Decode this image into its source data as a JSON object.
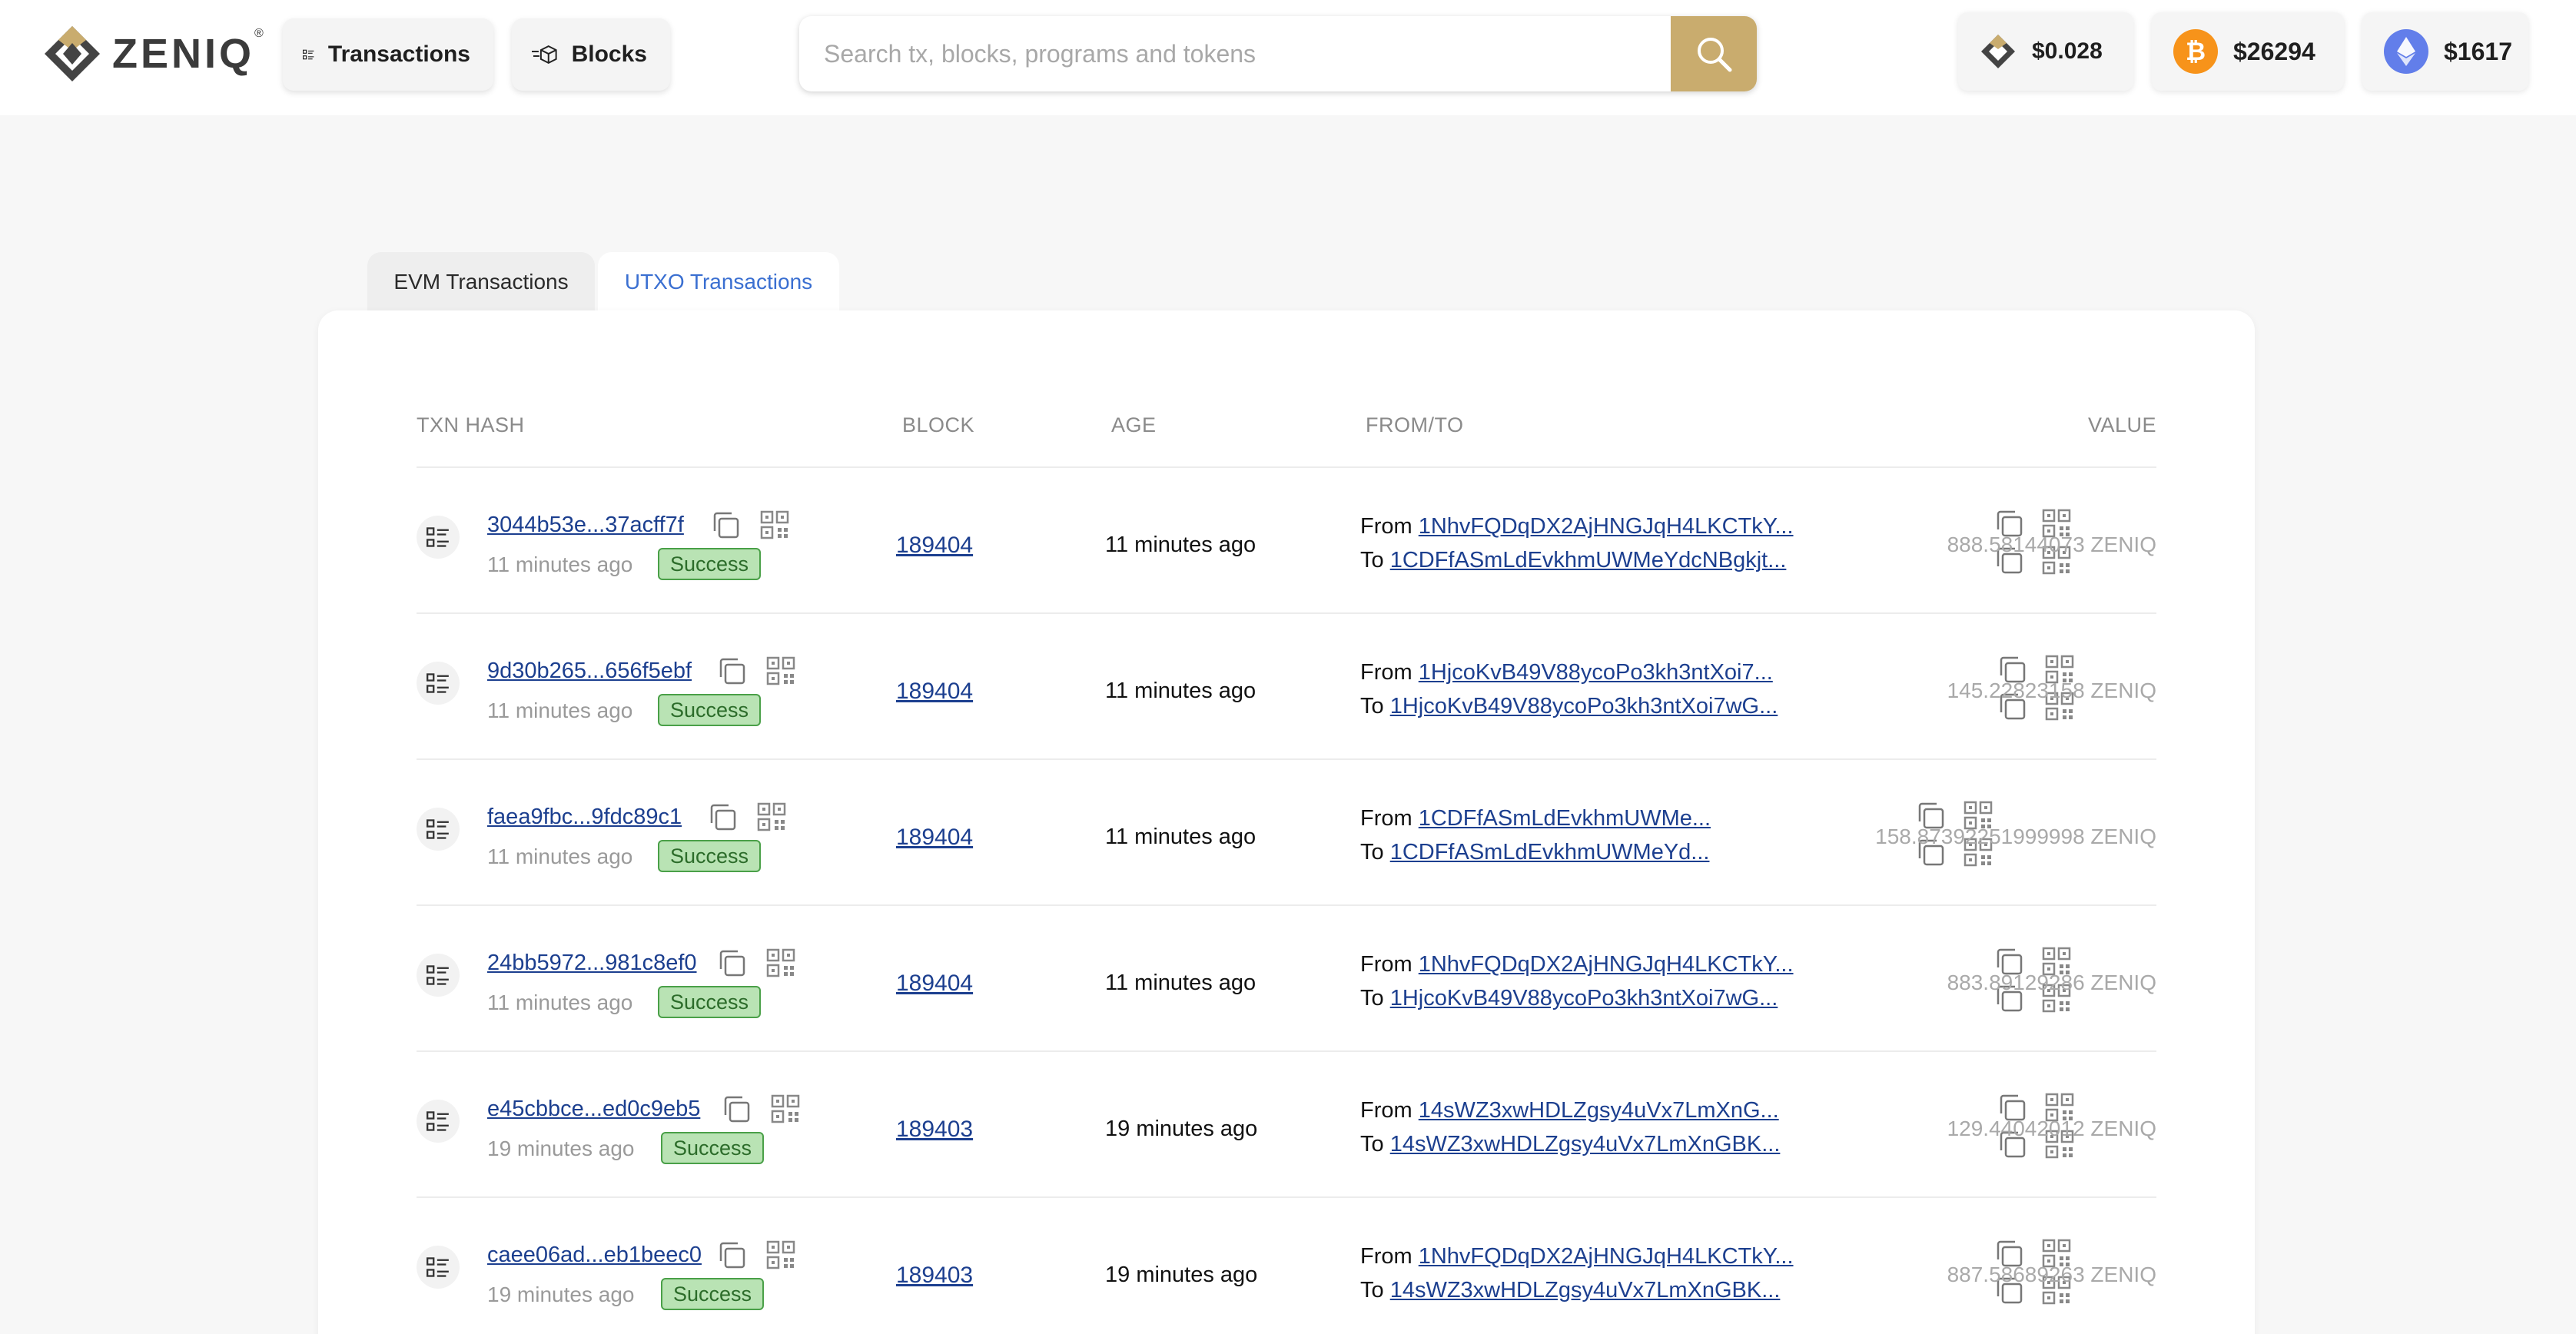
{
  "header": {
    "logo_text": "ZENIQ",
    "logo_reg": "®",
    "nav": {
      "transactions": "Transactions",
      "blocks": "Blocks"
    },
    "search": {
      "placeholder": "Search tx, blocks, programs and tokens"
    },
    "prices": {
      "zeniq": "$0.028",
      "btc": "$26294",
      "eth": "$1617"
    }
  },
  "colors": {
    "accent_gold": "#c9ac6e",
    "link_blue": "#1c3f8f",
    "tab_active": "#3a6fd1",
    "success_bg": "#b9e3b4",
    "success_border": "#4aa048",
    "btc_orange": "#f7931a",
    "eth_blue": "#627eea"
  },
  "icons": {
    "nav_transactions": "list-icon",
    "nav_blocks": "cube-icon",
    "search": "search-icon",
    "copy": "copy-icon",
    "qr": "qr-code-icon",
    "row_type": "list-icon"
  },
  "tabs": [
    {
      "label": "EVM Transactions",
      "active": false
    },
    {
      "label": "UTXO Transactions",
      "active": true
    }
  ],
  "table": {
    "columns": {
      "hash": "TXN HASH",
      "block": "BLOCK",
      "age": "AGE",
      "from_to": "FROM/TO",
      "value": "VALUE"
    },
    "from_label": "From",
    "to_label": "To",
    "rows": [
      {
        "hash": "3044b53e...37acff7f",
        "sub_age": "11 minutes ago",
        "status": "Success",
        "block": "189404",
        "age": "11 minutes ago",
        "from": "1NhvFQDqDX2AjHNGJqH4LKCTkY...",
        "to": "1CDFfASmLdEvkhmUWMeYdcNBgkjt...",
        "value": "888.58144073 ZENIQ"
      },
      {
        "hash": "9d30b265...656f5ebf",
        "sub_age": "11 minutes ago",
        "status": "Success",
        "block": "189404",
        "age": "11 minutes ago",
        "from": "1HjcoKvB49V88ycoPo3kh3ntXoi7...",
        "to": "1HjcoKvB49V88ycoPo3kh3ntXoi7wG...",
        "value": "145.22823158 ZENIQ"
      },
      {
        "hash": "faea9fbc...9fdc89c1",
        "sub_age": "11 minutes ago",
        "status": "Success",
        "block": "189404",
        "age": "11 minutes ago",
        "from": "1CDFfASmLdEvkhmUWMe...",
        "to": "1CDFfASmLdEvkhmUWMeYd...",
        "value": "158.87392251999998 ZENIQ"
      },
      {
        "hash": "24bb5972...981c8ef0",
        "sub_age": "11 minutes ago",
        "status": "Success",
        "block": "189404",
        "age": "11 minutes ago",
        "from": "1NhvFQDqDX2AjHNGJqH4LKCTkY...",
        "to": "1HjcoKvB49V88ycoPo3kh3ntXoi7wG...",
        "value": "883.89129286 ZENIQ"
      },
      {
        "hash": "e45cbbce...ed0c9eb5",
        "sub_age": "19 minutes ago",
        "status": "Success",
        "block": "189403",
        "age": "19 minutes ago",
        "from": "14sWZ3xwHDLZgsy4uVx7LmXnG...",
        "to": "14sWZ3xwHDLZgsy4uVx7LmXnGBK...",
        "value": "129.44042012 ZENIQ"
      },
      {
        "hash": "caee06ad...eb1beec0",
        "sub_age": "19 minutes ago",
        "status": "Success",
        "block": "189403",
        "age": "19 minutes ago",
        "from": "1NhvFQDqDX2AjHNGJqH4LKCTkY...",
        "to": "14sWZ3xwHDLZgsy4uVx7LmXnGBK...",
        "value": "887.58689263 ZENIQ"
      }
    ]
  }
}
